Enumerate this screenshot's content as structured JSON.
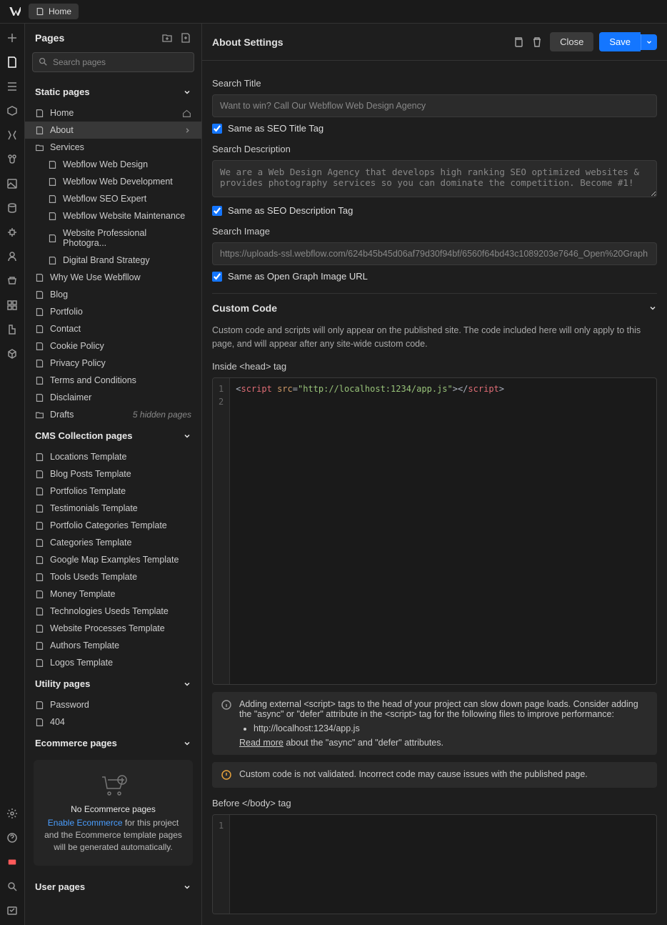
{
  "topbar": {
    "crumb": "Home"
  },
  "sidebar": {
    "title": "Pages",
    "search_placeholder": "Search pages",
    "sections": {
      "static": {
        "title": "Static pages",
        "items": [
          {
            "label": "Home",
            "icon": "page",
            "home": true
          },
          {
            "label": "About",
            "icon": "page",
            "selected": true,
            "chevron": true
          },
          {
            "label": "Services",
            "icon": "folder"
          },
          {
            "label": "Webflow Web Design",
            "icon": "page",
            "indent": true
          },
          {
            "label": "Webflow Web Development",
            "icon": "page",
            "indent": true
          },
          {
            "label": "Webflow SEO Expert",
            "icon": "page",
            "indent": true
          },
          {
            "label": "Webflow Website Maintenance",
            "icon": "page",
            "indent": true
          },
          {
            "label": "Website Professional Photogra...",
            "icon": "page",
            "indent": true
          },
          {
            "label": "Digital Brand Strategy",
            "icon": "page",
            "indent": true
          },
          {
            "label": "Why We Use Webfllow",
            "icon": "page"
          },
          {
            "label": "Blog",
            "icon": "page"
          },
          {
            "label": "Portfolio",
            "icon": "page"
          },
          {
            "label": "Contact",
            "icon": "page"
          },
          {
            "label": "Cookie Policy",
            "icon": "page"
          },
          {
            "label": "Privacy Policy",
            "icon": "page"
          },
          {
            "label": "Terms and Conditions",
            "icon": "page"
          },
          {
            "label": "Disclaimer",
            "icon": "page"
          },
          {
            "label": "Drafts",
            "icon": "folder",
            "tag": "5 hidden pages"
          }
        ]
      },
      "cms": {
        "title": "CMS Collection pages",
        "items": [
          {
            "label": "Locations Template"
          },
          {
            "label": "Blog Posts Template"
          },
          {
            "label": "Portfolios Template"
          },
          {
            "label": "Testimonials Template"
          },
          {
            "label": "Portfolio Categories Template"
          },
          {
            "label": "Categories Template"
          },
          {
            "label": "Google Map Examples Template"
          },
          {
            "label": "Tools Useds Template"
          },
          {
            "label": "Money Template"
          },
          {
            "label": "Technologies Useds Template"
          },
          {
            "label": "Website Processes Template"
          },
          {
            "label": "Authors Template"
          },
          {
            "label": "Logos Template"
          }
        ]
      },
      "utility": {
        "title": "Utility pages",
        "items": [
          {
            "label": "Password"
          },
          {
            "label": "404"
          }
        ]
      },
      "ecommerce": {
        "title": "Ecommerce pages",
        "empty_title": "No Ecommerce pages",
        "empty_link": "Enable Ecommerce",
        "empty_text": " for this project and the Ecommerce template pages will be generated automatically."
      },
      "user": {
        "title": "User pages"
      }
    }
  },
  "settings": {
    "title": "About Settings",
    "close": "Close",
    "save": "Save",
    "search_title_label": "Search Title",
    "search_title_value": "Want to win? Call Our Webflow Web Design Agency",
    "same_title": "Same as SEO Title Tag",
    "search_desc_label": "Search Description",
    "search_desc_value": "We are a Web Design Agency that develops high ranking SEO optimized websites & provides photography services so you can dominate the competition. Become #1!",
    "same_desc": "Same as SEO Description Tag",
    "search_image_label": "Search Image",
    "search_image_value": "https://uploads-ssl.webflow.com/624b45b45d06af79d30f94bf/6560f64bd43c1089203e7646_Open%20Graph",
    "same_image": "Same as Open Graph Image URL",
    "custom_code_title": "Custom Code",
    "custom_code_desc": "Custom code and scripts will only appear on the published site. The code included here will only apply to this page, and will appear after any site-wide custom code.",
    "head_label": "Inside <head> tag",
    "body_label": "Before </body> tag",
    "alert1_text": "Adding external <script> tags to the head of your project can slow down page loads. Consider adding the \"async\" or \"defer\" attribute in the <script> tag for the following files to improve performance:",
    "alert1_file": "http://localhost:1234/app.js",
    "alert1_readmore": "Read more",
    "alert1_suffix": " about the \"async\" and \"defer\" attributes.",
    "alert2_text": "Custom code is not validated. Incorrect code may cause issues with the published page."
  }
}
